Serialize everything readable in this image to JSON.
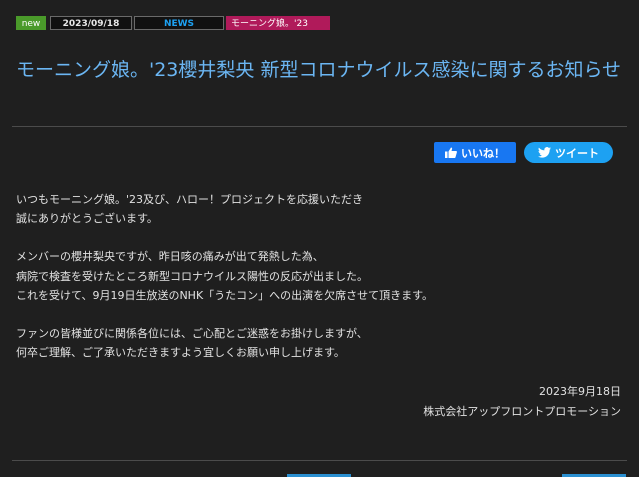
{
  "tags": {
    "new": "new",
    "date": "2023/09/18",
    "category": "NEWS",
    "group": "モーニング娘。'23"
  },
  "article": {
    "title": "モーニング娘。'23櫻井梨央 新型コロナウイルス感染に関するお知らせ",
    "paragraphs": [
      [
        "いつもモーニング娘。'23及び、ハロー！プロジェクトを応援いただき",
        "誠にありがとうございます。"
      ],
      [
        "メンバーの櫻井梨央ですが、昨日咳の痛みが出て発熱した為、",
        "病院で検査を受けたところ新型コロナウイルス陽性の反応が出ました。",
        "これを受けて、9月19日生放送のNHK「うたコン」への出演を欠席させて頂きます。"
      ],
      [
        "ファンの皆様並びに関係各位には、ご心配とご迷惑をお掛けしますが、",
        "何卒ご理解、ご了承いただきますよう宜しくお願い申し上げます。"
      ]
    ],
    "date": "2023年9月18日",
    "company": "株式会社アップフロントプロモーション"
  },
  "share": {
    "like_label": "いいね！",
    "tweet_label": "ツイート",
    "like_icon": "thumbs-up-icon",
    "tweet_icon": "twitter-bird-icon"
  },
  "colors": {
    "background": "#1f1f1f",
    "title": "#6bb6f3",
    "new_badge": "#4a9a2a",
    "group_badge": "#b01a5a",
    "like": "#1877f2",
    "tweet": "#1da1f2"
  }
}
